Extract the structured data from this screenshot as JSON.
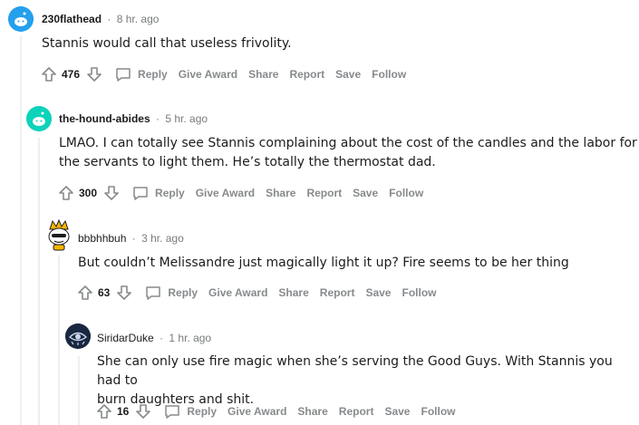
{
  "comments": [
    {
      "author": "230flathead",
      "time": "8 hr. ago",
      "body_lines": [
        "Stannis would call that useless frivolity."
      ],
      "score": "476",
      "avatar_color": "#24a0ed"
    },
    {
      "author": "the-hound-abides",
      "time": "5 hr. ago",
      "body_lines": [
        "LMAO. I can totally see Stannis complaining about the cost of the candles and the labor for",
        "the servants to light them. He’s totally the thermostat dad."
      ],
      "score": "300",
      "avatar_color": "#0dd3bb"
    },
    {
      "author": "bbbhhbuh",
      "time": "3 hr. ago",
      "body_lines": [
        "But couldn’t Melissandre just magically light it up? Fire seems to be her thing"
      ],
      "score": "63",
      "avatar_color": "#ffffff"
    },
    {
      "author": "SiridarDuke",
      "time": "1 hr. ago",
      "body_lines": [
        "She can only use fire magic when she’s serving the Good Guys. With Stannis you had to",
        "burn daughters and shit."
      ],
      "score": "16",
      "avatar_color": "#1a2740"
    }
  ],
  "actions": {
    "reply": "Reply",
    "give_award": "Give Award",
    "share": "Share",
    "report": "Report",
    "save": "Save",
    "follow": "Follow"
  },
  "separator": "·"
}
